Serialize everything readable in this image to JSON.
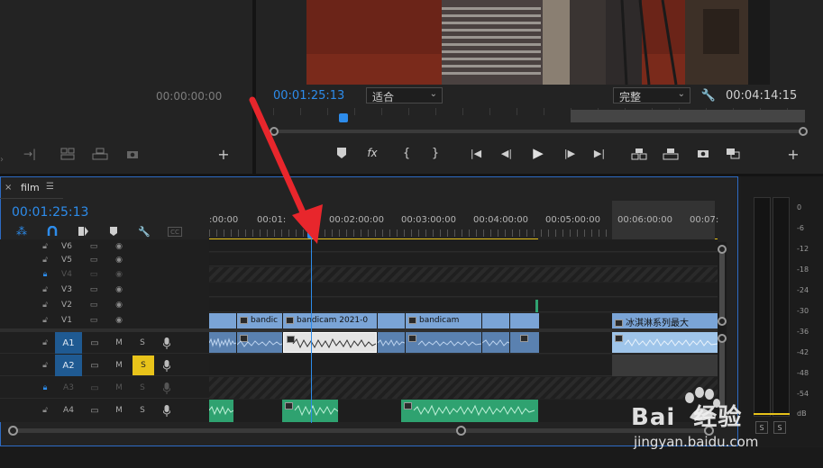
{
  "source_monitor": {
    "timecode": "00:00:00:00"
  },
  "program_monitor": {
    "current_timecode": "00:01:25:13",
    "fit_label": "适合",
    "quality_label": "完整",
    "duration": "00:04:14:15"
  },
  "timeline": {
    "sequence_name": "film",
    "close_glyph": "×",
    "menu_glyph": "☰",
    "timecode": "00:01:25:13",
    "ruler_labels": [
      ":00:00",
      "00:01:",
      "00:02:00:00",
      "00:03:00:00",
      "00:04:00:00",
      "00:05:00:00",
      "00:06:00:00",
      "00:07:"
    ],
    "video_tracks": [
      {
        "label": "V6",
        "locked": false,
        "enabled": true
      },
      {
        "label": "V5",
        "locked": false,
        "enabled": true
      },
      {
        "label": "V4",
        "locked": true,
        "enabled": false
      },
      {
        "label": "V3",
        "locked": false,
        "enabled": true
      },
      {
        "label": "V2",
        "locked": false,
        "enabled": true
      },
      {
        "label": "V1",
        "locked": false,
        "enabled": true
      }
    ],
    "audio_tracks": [
      {
        "label": "A1",
        "source": "A1",
        "m": "M",
        "s": "S",
        "locked": false,
        "solo_on": false
      },
      {
        "label": "A2",
        "source": "A2",
        "m": "M",
        "s": "S",
        "locked": false,
        "solo_on": true
      },
      {
        "label": "A3",
        "source": "",
        "m": "M",
        "s": "S",
        "locked": true,
        "solo_on": false
      },
      {
        "label": "A4",
        "source": "",
        "m": "M",
        "s": "S",
        "locked": false,
        "solo_on": false
      }
    ],
    "v1_clips": [
      "bandic",
      "bandicam 2021-0",
      "bandicam",
      "冰淇淋系列最大"
    ],
    "colors": {
      "timecode": "#2d8ceb",
      "video_clip": "#7aa4d6",
      "audio_clip": "#5a81b0",
      "green_clip": "#2fa270",
      "annotation_arrow": "#e8262c",
      "solo_on": "#e8c31a"
    }
  },
  "audio_meter": {
    "scale": [
      "0",
      "-6",
      "-12",
      "-18",
      "-24",
      "-30",
      "-36",
      "-42",
      "-48",
      "-54",
      "dB"
    ],
    "solo_labels": [
      "S",
      "S"
    ]
  },
  "watermark": {
    "brand": "Bai  经验",
    "url": "jingyan.baidu.com"
  }
}
